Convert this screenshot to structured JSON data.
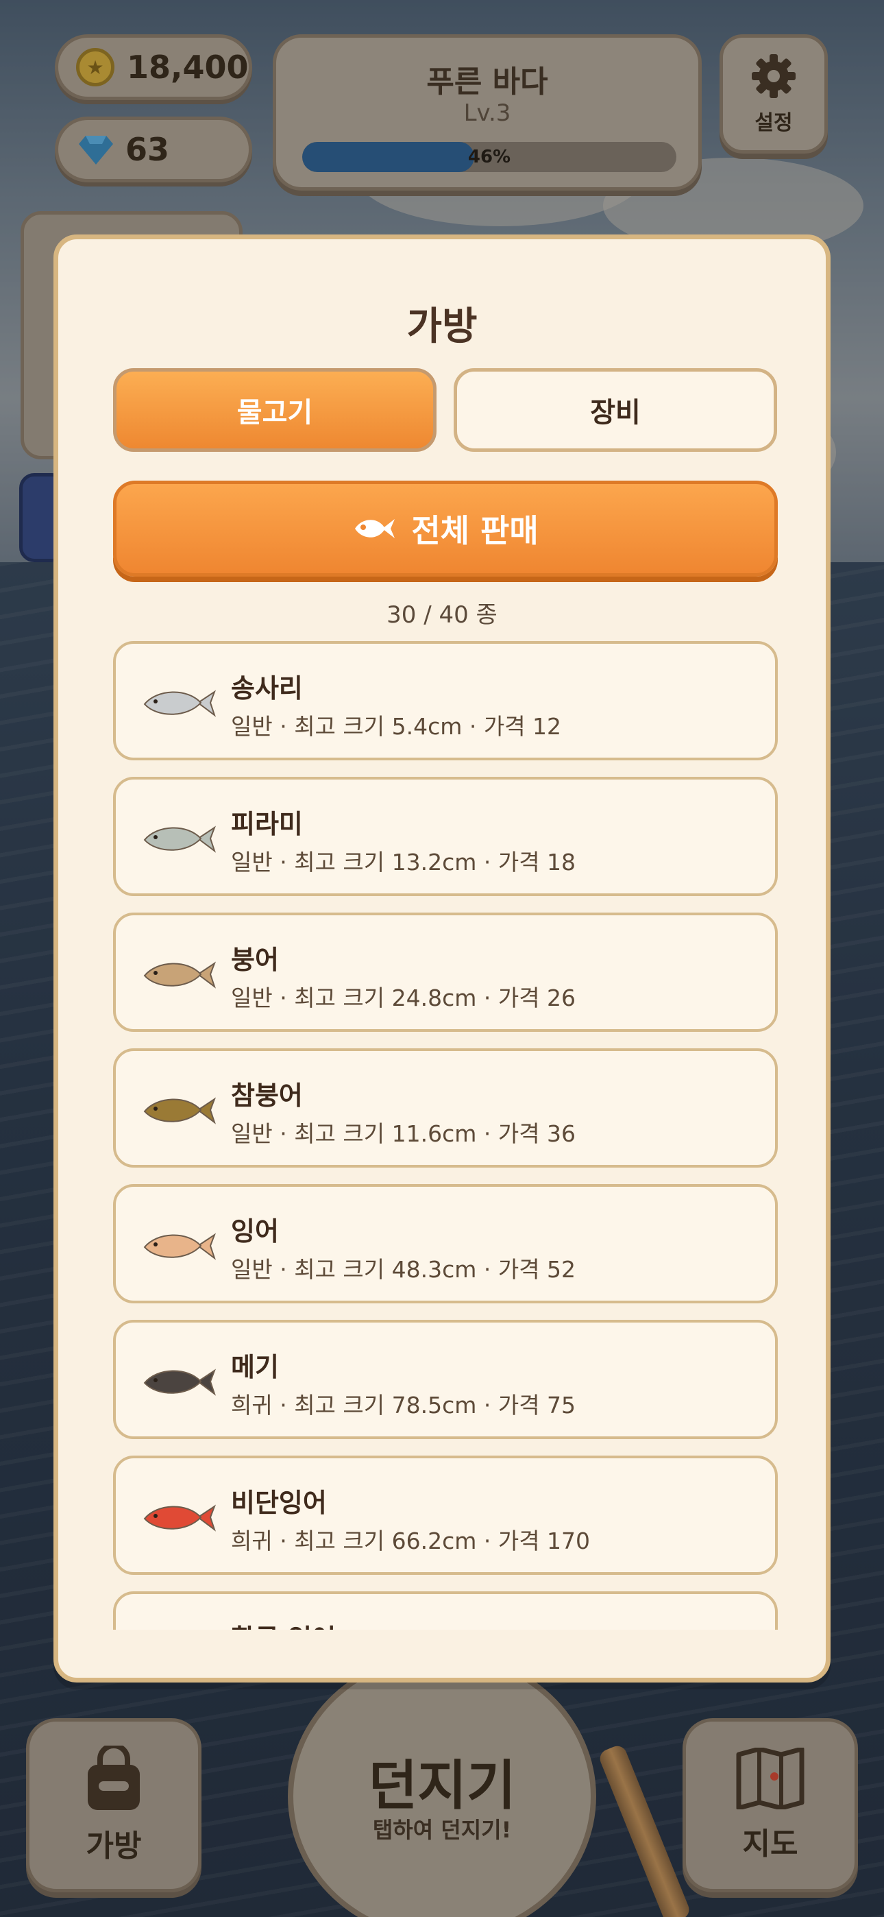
{
  "hud": {
    "coins": "18,400",
    "gems": "63",
    "stage_name": "푸른 바다",
    "stage_level": "Lv.3",
    "progress_text": "46%",
    "progress_fraction": 0.46,
    "settings_label": "설정"
  },
  "modal": {
    "title": "가방",
    "tabs": [
      {
        "label": "물고기",
        "active": true
      },
      {
        "label": "장비",
        "active": false
      }
    ],
    "sell_all_label": "전체 판매",
    "count_text": "30 / 40 종",
    "fish": [
      {
        "name": "송사리",
        "info": "일반 · 최고 크기 5.4cm · 가격 12",
        "icon": "fish-silver",
        "color": "#c9ccce"
      },
      {
        "name": "피라미",
        "info": "일반 · 최고 크기 13.2cm · 가격 18",
        "icon": "fish-silver-stripe",
        "color": "#b7bfb7"
      },
      {
        "name": "붕어",
        "info": "일반 · 최고 크기 24.8cm · 가격 26",
        "icon": "fish-crucian",
        "color": "#c8a377"
      },
      {
        "name": "참붕어",
        "info": "일반 · 최고 크기 11.6cm · 가격 36",
        "icon": "fish-crucian-dark",
        "color": "#9a7a35"
      },
      {
        "name": "잉어",
        "info": "일반 · 최고 크기 48.3cm · 가격 52",
        "icon": "fish-carp",
        "color": "#e8b48a"
      },
      {
        "name": "메기",
        "info": "희귀 · 최고 크기 78.5cm · 가격 75",
        "icon": "fish-catfish",
        "color": "#4b4440"
      },
      {
        "name": "비단잉어",
        "info": "희귀 · 최고 크기 66.2cm · 가격 170",
        "icon": "fish-koi",
        "color": "#e04a35"
      },
      {
        "name": "황금 잉어",
        "info": "",
        "icon": "fish-golden",
        "color": "#d9a441"
      }
    ]
  },
  "bottom": {
    "bag_label": "가방",
    "cast_title": "던지기",
    "cast_sub": "탭하여 던지기!",
    "map_label": "지도"
  }
}
